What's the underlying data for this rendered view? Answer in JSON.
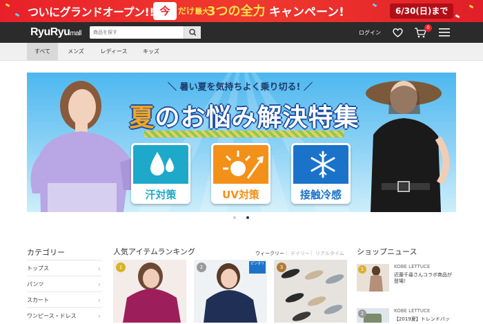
{
  "promo": {
    "text_left": "ついにグランドオープン!!",
    "badge": "今",
    "text_only": "だけ!",
    "text_max": "最大",
    "text_three": "3つの全力",
    "text_campaign": "キャンペーン!",
    "date": "6/30(日)まで",
    "colors": {
      "bg": "#e8202a",
      "accent": "#ffe14a"
    }
  },
  "header": {
    "logo": "RyuRyu",
    "logo_suffix": "mall",
    "search_placeholder": "商品を探す",
    "login": "ログイン",
    "cart_count": "0",
    "icons": [
      "search-icon",
      "heart-icon",
      "cart-icon",
      "menu-icon"
    ]
  },
  "nav": {
    "tabs": [
      {
        "label": "すべて",
        "active": true
      },
      {
        "label": "メンズ",
        "active": false
      },
      {
        "label": "レディース",
        "active": false
      },
      {
        "label": "キッズ",
        "active": false
      }
    ]
  },
  "hero": {
    "subtitle": "＼ 暑い夏を気持ちよく乗り切る! ／",
    "title_first": "夏",
    "title_rest": "のお悩み解決特集",
    "features": [
      {
        "label": "汗対策",
        "icon": "droplet-icon",
        "color": "#1ea8c9"
      },
      {
        "label": "UV対策",
        "icon": "sun-icon",
        "color": "#f39019"
      },
      {
        "label": "接触冷感",
        "icon": "snowflake-icon",
        "color": "#1a73c9"
      }
    ],
    "carousel_active": 2,
    "carousel_total": 2
  },
  "categories": {
    "title": "カテゴリー",
    "items": [
      "トップス",
      "パンツ",
      "スカート",
      "ワンピース・ドレス"
    ]
  },
  "ranking": {
    "title": "人気アイテムランキング",
    "periods": [
      {
        "label": "ウィークリー",
        "active": true
      },
      {
        "label": "デイリー",
        "active": false
      },
      {
        "label": "リアルタイム",
        "active": false
      }
    ],
    "items": [
      {
        "rank": "1",
        "color": "#d8b22b"
      },
      {
        "rank": "2",
        "color": "#9a9a9a"
      },
      {
        "rank": "3",
        "color": "#b07c3a"
      }
    ],
    "sticker": "ピンタリ"
  },
  "news": {
    "title": "ショップニュース",
    "items": [
      {
        "num": "1",
        "brand": "KOBE LETTUCE",
        "text": "近藤千尋さんコラボ商品が登場！"
      },
      {
        "num": "2",
        "brand": "KOBE LETTUCE",
        "text": "【2019夏】トレンドバッ"
      }
    ]
  }
}
